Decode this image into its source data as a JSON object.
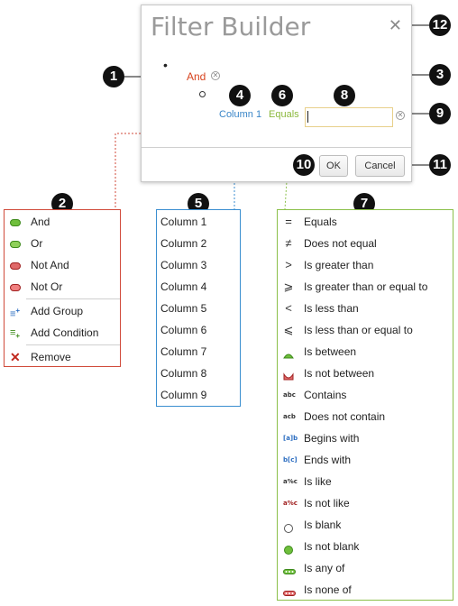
{
  "dialog": {
    "title": "Filter Builder",
    "group_operation": "And",
    "condition": {
      "field": "Column 1",
      "operation": "Equals",
      "value": ""
    },
    "ok_label": "OK",
    "cancel_label": "Cancel"
  },
  "callouts": [
    "1",
    "2",
    "3",
    "4",
    "5",
    "6",
    "7",
    "8",
    "9",
    "10",
    "11",
    "12"
  ],
  "group_menu": {
    "items": [
      {
        "label": "And",
        "icon": "and-icon"
      },
      {
        "label": "Or",
        "icon": "or-icon"
      },
      {
        "label": "Not And",
        "icon": "not-and-icon"
      },
      {
        "label": "Not Or",
        "icon": "not-or-icon"
      },
      {
        "label": "Add Group",
        "icon": "add-group-icon"
      },
      {
        "label": "Add Condition",
        "icon": "add-condition-icon"
      },
      {
        "label": "Remove",
        "icon": "remove-icon"
      }
    ]
  },
  "field_menu": {
    "items": [
      "Column 1",
      "Column 2",
      "Column 3",
      "Column 4",
      "Column 5",
      "Column 6",
      "Column 7",
      "Column 8",
      "Column 9"
    ]
  },
  "condition_menu": {
    "items": [
      {
        "label": "Equals",
        "icon": "equals-icon"
      },
      {
        "label": "Does not equal",
        "icon": "not-equal-icon"
      },
      {
        "label": "Is greater than",
        "icon": "greater-than-icon"
      },
      {
        "label": "Is greater than or equal to",
        "icon": "greater-equal-icon"
      },
      {
        "label": "Is less than",
        "icon": "less-than-icon"
      },
      {
        "label": "Is less than or equal to",
        "icon": "less-equal-icon"
      },
      {
        "label": "Is between",
        "icon": "between-icon"
      },
      {
        "label": "Is not between",
        "icon": "not-between-icon"
      },
      {
        "label": "Contains",
        "icon": "contains-icon"
      },
      {
        "label": "Does not contain",
        "icon": "not-contains-icon"
      },
      {
        "label": "Begins with",
        "icon": "begins-with-icon"
      },
      {
        "label": "Ends with",
        "icon": "ends-with-icon"
      },
      {
        "label": "Is like",
        "icon": "like-icon"
      },
      {
        "label": "Is not like",
        "icon": "not-like-icon"
      },
      {
        "label": "Is blank",
        "icon": "blank-icon"
      },
      {
        "label": "Is not blank",
        "icon": "not-blank-icon"
      },
      {
        "label": "Is any of",
        "icon": "any-of-icon"
      },
      {
        "label": "Is none of",
        "icon": "none-of-icon"
      }
    ],
    "icon_text": {
      "contains": "abc",
      "not_contains": "acb",
      "begins": "[a]b",
      "ends": "b[c]",
      "like": "a%c",
      "not_like": "a%c"
    }
  },
  "colors": {
    "group_accent": "#d7431e",
    "field_accent": "#3a86c8",
    "condition_accent": "#8bb83c"
  }
}
